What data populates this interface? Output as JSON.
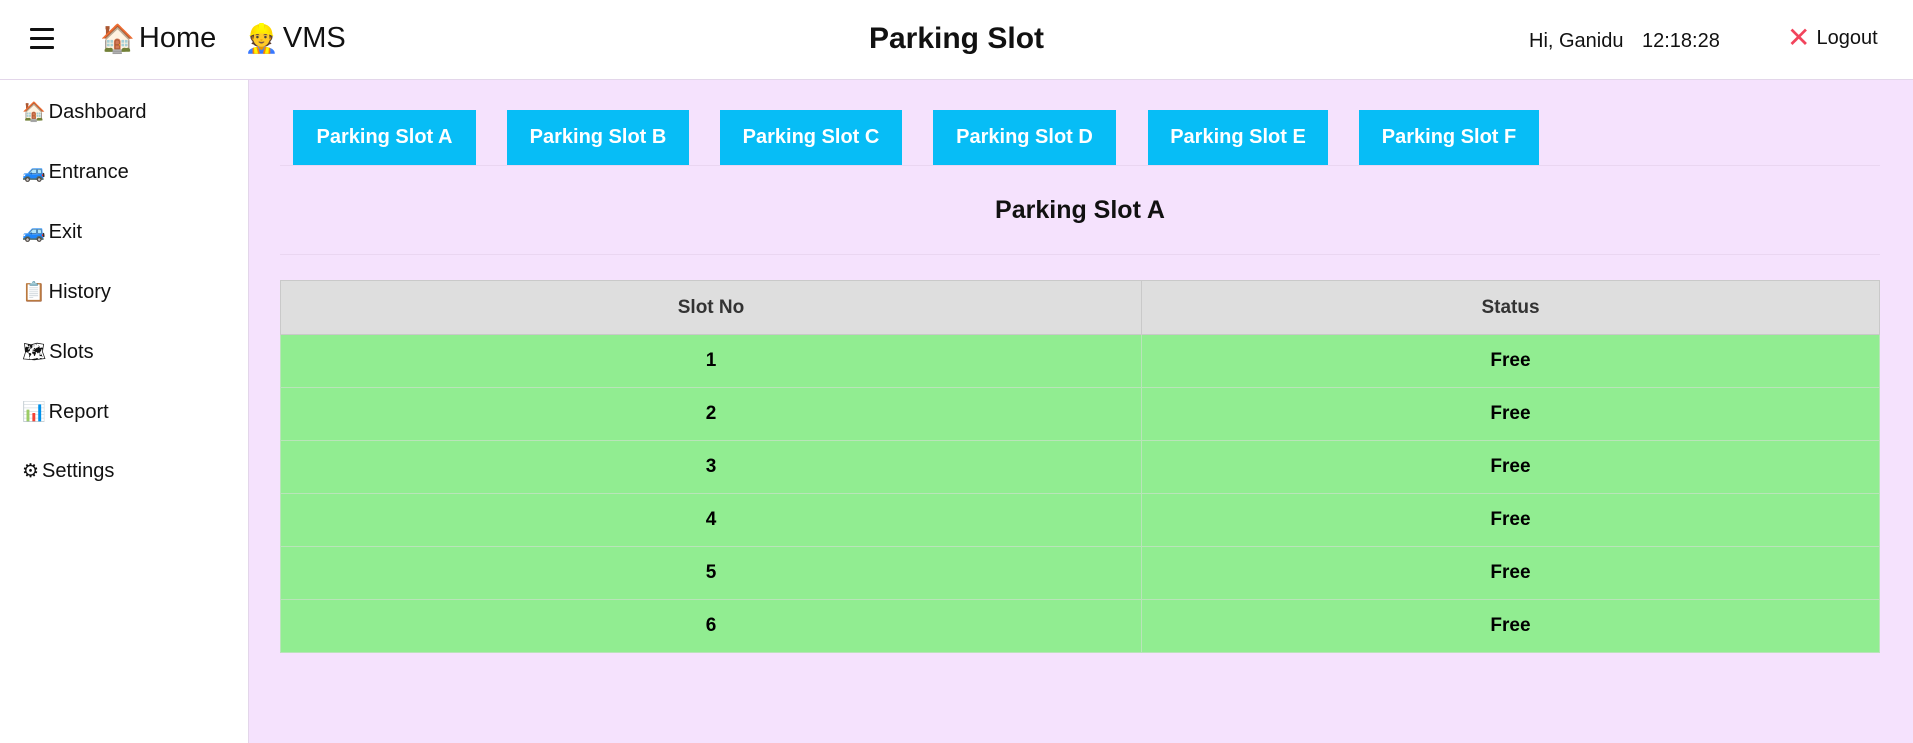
{
  "header": {
    "home_label": "Home",
    "home_icon": "🏠",
    "vms_label": "VMS",
    "vms_icon": "👷",
    "page_title": "Parking Slot",
    "greeting": "Hi, Ganidu",
    "time": "12:18:28",
    "logout_label": "Logout",
    "logout_icon": "✕"
  },
  "sidebar": {
    "items": [
      {
        "icon": "🏠",
        "label": "Dashboard"
      },
      {
        "icon": "🚙",
        "label": "Entrance"
      },
      {
        "icon": "🚙",
        "label": "Exit"
      },
      {
        "icon": "📋",
        "label": "History"
      },
      {
        "icon": "🗺",
        "label": "Slots"
      },
      {
        "icon": "📊",
        "label": "Report"
      },
      {
        "icon": "⚙",
        "label": "Settings"
      }
    ]
  },
  "slot_tabs": [
    "Parking Slot A",
    "Parking Slot B",
    "Parking Slot C",
    "Parking Slot D",
    "Parking Slot E",
    "Parking Slot F"
  ],
  "section": {
    "title": "Parking Slot A"
  },
  "table": {
    "headers": [
      "Slot No",
      "Status"
    ],
    "rows": [
      [
        "1",
        "Free"
      ],
      [
        "2",
        "Free"
      ],
      [
        "3",
        "Free"
      ],
      [
        "4",
        "Free"
      ],
      [
        "5",
        "Free"
      ],
      [
        "6",
        "Free"
      ]
    ]
  },
  "colors": {
    "tab_button": "#07bdf6",
    "free_row": "#91ed91",
    "main_bg": "#f5e2fd",
    "logout_x": "#f2445c"
  }
}
